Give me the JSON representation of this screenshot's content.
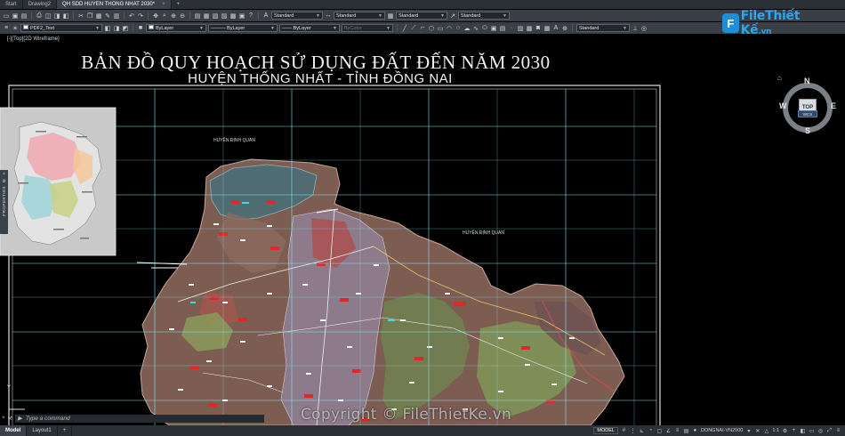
{
  "tabs": [
    {
      "label": "Start",
      "active": false
    },
    {
      "label": "Drawing2",
      "active": false
    },
    {
      "label": "QH SDD HUYEN THONG NHAT 2030*",
      "active": true
    }
  ],
  "toolbar1": {
    "text_style": "Standard",
    "dim_style": "Standard",
    "table_style": "Standard",
    "mleader_style": "Standard"
  },
  "toolbar2": {
    "layer": "PDF2_Text",
    "color": "ByLayer",
    "linetype": "ByLayer",
    "lineweight": "ByLayer",
    "plotstyle": "ByColor",
    "visual_style": "Standard"
  },
  "logo": {
    "brand": "File",
    "brand2": "Thiết Kế",
    "tld": ".vn"
  },
  "viewport": {
    "label": "[-][Top][2D Wireframe]",
    "title": "BẢN ĐỒ QUY HOẠCH SỬ DỤNG ĐẤT ĐẾN NĂM 2030",
    "subtitle": "HUYỆN THỐNG NHẤT - TỈNH ĐỒNG NAI",
    "labels": {
      "north": "HUYỆN ĐỊNH QUÁN",
      "east": "HUYỆN ĐỊNH QUÁN"
    }
  },
  "side_palette": {
    "title": "PROPERTIES"
  },
  "viewcube": {
    "top": "TOP",
    "n": "N",
    "s": "S",
    "e": "E",
    "w": "W",
    "wcs": "WCS"
  },
  "command": {
    "placeholder": "Type a command"
  },
  "watermark": "Copyright © FileThietKe.vn",
  "layout_tabs": [
    {
      "label": "Model",
      "active": true
    },
    {
      "label": "Layout1",
      "active": false
    }
  ],
  "status": {
    "model": "MODEL",
    "coord_system": "DONGNAI-VN2000",
    "scale": "1:1"
  },
  "colors": {
    "accent": "#2aa7ee",
    "grid": "#7fe7f2",
    "frame": "#e0e0e0"
  }
}
